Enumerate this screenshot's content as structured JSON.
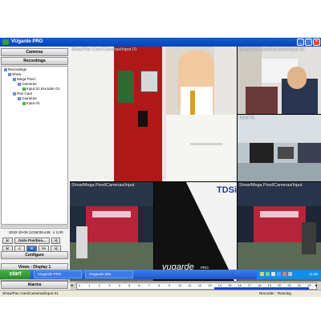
{
  "window": {
    "title": "VUgarde PRO"
  },
  "panel": {
    "cameras_label": "Cameras",
    "recordings_label": "Recordings",
    "tree": [
      {
        "label": "Recordings",
        "indent": 0
      },
      {
        "label": "Show",
        "indent": 1
      },
      {
        "label": "Mega Pixel",
        "indent": 2
      },
      {
        "label": "Cameras",
        "indent": 3
      },
      {
        "label": "Input 01 Encoder 01",
        "indent": 4
      },
      {
        "label": "Pan Cam",
        "indent": 2
      },
      {
        "label": "Cameras",
        "indent": 3
      },
      {
        "label": "Input 01",
        "indent": 4
      }
    ],
    "timestamp": "2010-10-06 12:55:09.449",
    "speed": "x 1.00",
    "goto_label": "Goto Position...",
    "playback": {
      "begin": "|<",
      "back": "<",
      "pause": "II",
      "fwd": ">>",
      "end": ">|"
    },
    "sync_label": "Synchronise Playback",
    "views_label": "Views : Display 1",
    "stored_views_label": "Stored Views",
    "alarms_label": "Alarms",
    "configure_label": "Configure"
  },
  "tiles": {
    "main_caption": "Show/Pan Cam/Cameras/Input 01",
    "top_right_caption": "Show/Pan Cam/Cameras/Input 01",
    "mid_right_caption": "Input 01",
    "bottom_left_caption": "Show/Mega Pixel/Cameras/Input",
    "bottom_right_caption": "Show/Mega Pixel/Cameras/Input",
    "logo_main": "vugarde",
    "logo_suffix": "PRO",
    "brand": "TDSi"
  },
  "timeline": {
    "ticks": [
      "0",
      "1",
      "2",
      "3",
      "4",
      "5",
      "6",
      "7",
      "8",
      "9",
      "10",
      "11",
      "12",
      "13",
      "14",
      "15",
      "16",
      "17",
      "18",
      "19",
      "20",
      "21",
      "22",
      "23"
    ]
  },
  "status": {
    "left": "Show/Pan Cam/Cameras/Input 01",
    "right": "Recorder : Running"
  },
  "taskbar": {
    "start_label": "start",
    "tasks": [
      "VUgarde PRO",
      "VUgarde Site"
    ],
    "clock": "11:36"
  }
}
